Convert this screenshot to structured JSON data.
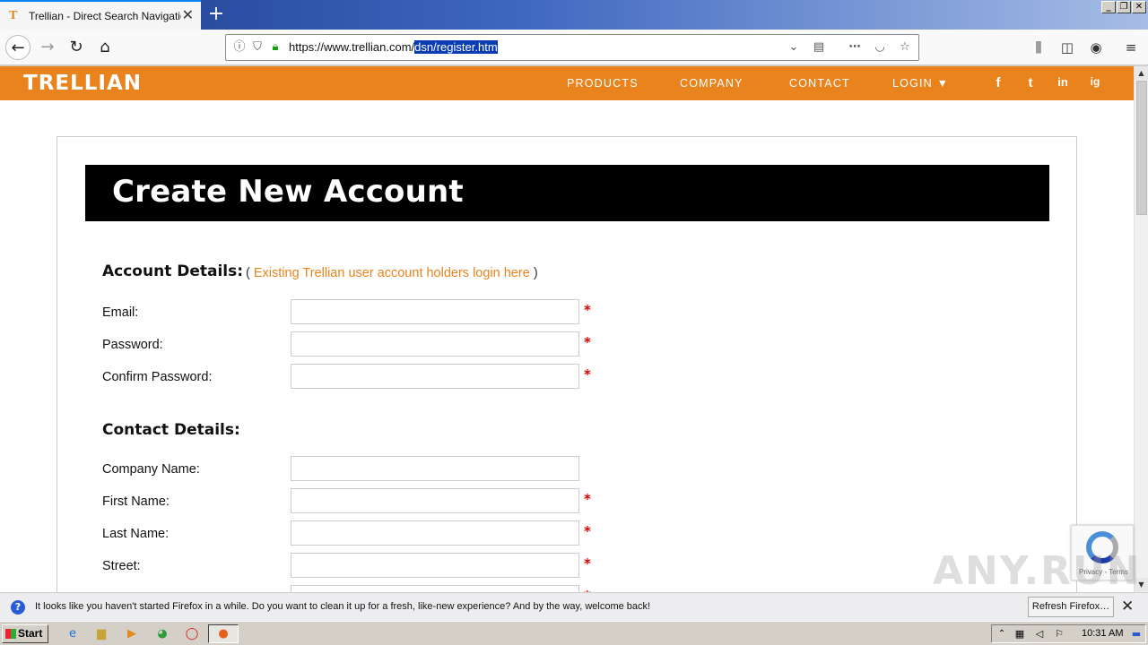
{
  "browser": {
    "tab_title": "Trellian - Direct Search Navigation",
    "tab_favicon": "T",
    "url_prefix": "https://www.trellian.com/",
    "url_selected": "dsn/register.htm"
  },
  "site": {
    "logo": "TRELLIAN",
    "nav": [
      "PRODUCTS",
      "COMPANY",
      "CONTACT",
      "LOGIN ▼"
    ],
    "social": [
      "f",
      "t",
      "in",
      "ig"
    ],
    "brand_color": "#e8831e"
  },
  "form": {
    "heading": "Create New Account",
    "account_section": "Account Details:",
    "existing_open": "(",
    "existing_link": "Existing Trellian user account holders login here",
    "existing_close": ")",
    "contact_section": "Contact Details:",
    "required_mark": "*",
    "fields": {
      "email": "Email:",
      "password": "Password:",
      "confirm_password": "Confirm Password:",
      "company": "Company Name:",
      "first_name": "First Name:",
      "last_name": "Last Name:",
      "street": "Street:"
    }
  },
  "recaptcha": {
    "text": "Privacy - Terms"
  },
  "watermark": "ANY.RUN",
  "notification": {
    "message": "It looks like you haven't started Firefox in a while. Do you want to clean it up for a fresh, like-new experience? And by the way, welcome back!",
    "button": "Refresh Firefox…"
  },
  "taskbar": {
    "start": "Start",
    "clock": "10:31 AM"
  }
}
